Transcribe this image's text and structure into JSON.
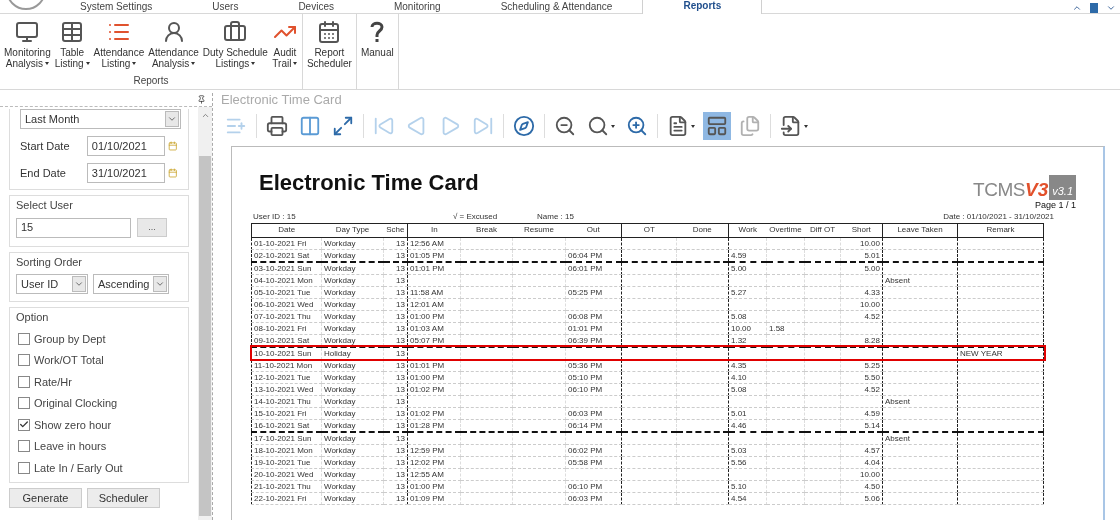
{
  "ribbon": {
    "tabs": [
      {
        "label": "System Settings",
        "selected": false
      },
      {
        "label": "Users",
        "selected": false
      },
      {
        "label": "Devices",
        "selected": false
      },
      {
        "label": "Monitoring",
        "selected": false
      },
      {
        "label": "Scheduling & Attendance",
        "selected": false
      },
      {
        "label": "Reports",
        "selected": true
      }
    ],
    "groups": [
      {
        "label": "Reports",
        "buttons": [
          {
            "kind": "monitor",
            "lines": [
              "Monitoring",
              "Analysis"
            ],
            "dropdown": true
          },
          {
            "kind": "table",
            "lines": [
              "Table",
              "Listing"
            ],
            "dropdown": true
          },
          {
            "kind": "list",
            "lines": [
              "Attendance",
              "Listing"
            ],
            "dropdown": true
          },
          {
            "kind": "person",
            "lines": [
              "Attendance",
              "Analysis"
            ],
            "dropdown": true
          },
          {
            "kind": "briefcase",
            "lines": [
              "Duty Schedule",
              "Listings"
            ],
            "dropdown": true
          },
          {
            "kind": "trend",
            "lines": [
              "Audit",
              "Trail"
            ],
            "dropdown": true
          }
        ]
      },
      {
        "buttons": [
          {
            "kind": "calendar",
            "lines": [
              "Report",
              "Scheduler"
            ],
            "dropdown": false
          }
        ]
      },
      {
        "buttons": [
          {
            "kind": "help",
            "lines": [
              "Manual"
            ],
            "dropdown": false
          }
        ]
      }
    ]
  },
  "filter_panel": {
    "period": "Last Month",
    "start_date": {
      "label": "Start Date",
      "value": "01/10/2021"
    },
    "end_date": {
      "label": "End Date",
      "value": "31/10/2021"
    },
    "select_user": {
      "title": "Select User",
      "value": "15",
      "browse": "..."
    },
    "sorting": {
      "title": "Sorting Order",
      "field": "User ID",
      "order": "Ascending"
    },
    "option": {
      "title": "Option",
      "items": [
        {
          "label": "Group by Dept",
          "checked": false
        },
        {
          "label": "Work/OT Total",
          "checked": false
        },
        {
          "label": "Rate/Hr",
          "checked": false
        },
        {
          "label": "Original Clocking",
          "checked": false
        },
        {
          "label": "Show zero hour",
          "checked": true
        },
        {
          "label": "Leave in hours",
          "checked": false
        },
        {
          "label": "Late In / Early Out",
          "checked": false
        }
      ]
    },
    "buttons": [
      "Generate",
      "Scheduler"
    ]
  },
  "viewer": {
    "title": "Electronic Time Card",
    "toolbar": [
      {
        "kind": "select",
        "disabled": true,
        "selected": false,
        "dropdown": false
      },
      {
        "kind": "print",
        "disabled": false,
        "selected": false,
        "dropdown": false
      },
      {
        "kind": "margins",
        "disabled": false,
        "selected": false,
        "dropdown": false
      },
      {
        "kind": "fit",
        "disabled": false,
        "selected": false,
        "dropdown": false
      },
      {
        "kind": "first",
        "disabled": true,
        "selected": false,
        "dropdown": false
      },
      {
        "kind": "prev",
        "disabled": true,
        "selected": false,
        "dropdown": false
      },
      {
        "kind": "next",
        "disabled": true,
        "selected": false,
        "dropdown": false
      },
      {
        "kind": "last",
        "disabled": true,
        "selected": false,
        "dropdown": false
      },
      {
        "kind": "compass",
        "disabled": false,
        "selected": false,
        "dropdown": false
      },
      {
        "kind": "zoom-out",
        "disabled": false,
        "selected": false,
        "dropdown": false
      },
      {
        "kind": "zoom",
        "disabled": false,
        "selected": false,
        "dropdown": true
      },
      {
        "kind": "zoom-in",
        "disabled": false,
        "selected": false,
        "dropdown": false
      },
      {
        "kind": "document",
        "disabled": false,
        "selected": false,
        "dropdown": true
      },
      {
        "kind": "page-setup",
        "disabled": false,
        "selected": true,
        "dropdown": false
      },
      {
        "kind": "multipage",
        "disabled": true,
        "selected": false,
        "dropdown": false
      },
      {
        "kind": "export",
        "disabled": false,
        "selected": false,
        "dropdown": true
      }
    ]
  },
  "document": {
    "title": "Electronic Time Card",
    "logo": {
      "name": "TCMS",
      "mark": "V3",
      "version": "v3.1"
    },
    "page": "Page 1 / 1",
    "user_id": "User ID : 15",
    "legend": "√ = Excused",
    "name": "Name : 15",
    "date_range": "Date : 01/10/2021 - 31/10/2021",
    "columns": [
      "Date",
      "Day Type",
      "Sche",
      "In",
      "Break",
      "Resume",
      "Out",
      "OT",
      "Done",
      "Work",
      "Overtime",
      "Diff OT",
      "Short",
      "Leave Taken",
      "Remark"
    ],
    "rows": [
      {
        "date": "01-10-2021 Fri",
        "day_type": "Workday",
        "sche": "13",
        "in": "12:56 AM",
        "short": "10.00",
        "week_break": false,
        "highlighted": false
      },
      {
        "date": "02-10-2021 Sat",
        "day_type": "Workday",
        "sche": "13",
        "in": "01:05 PM",
        "out": "06:04 PM",
        "work": "4.59",
        "short": "5.01",
        "week_break": true,
        "highlighted": false
      },
      {
        "date": "03-10-2021 Sun",
        "day_type": "Workday",
        "sche": "13",
        "in": "01:01 PM",
        "out": "06:01 PM",
        "work": "5.00",
        "short": "5.00",
        "week_break": false,
        "highlighted": false
      },
      {
        "date": "04-10-2021 Mon",
        "day_type": "Workday",
        "sche": "13",
        "leave": "Absent",
        "week_break": false,
        "highlighted": false
      },
      {
        "date": "05-10-2021 Tue",
        "day_type": "Workday",
        "sche": "13",
        "in": "11:58 AM",
        "out": "05:25 PM",
        "work": "5.27",
        "short": "4.33",
        "week_break": false,
        "highlighted": false
      },
      {
        "date": "06-10-2021 Wed",
        "day_type": "Workday",
        "sche": "13",
        "in": "12:01 AM",
        "short": "10.00",
        "week_break": false,
        "highlighted": false
      },
      {
        "date": "07-10-2021 Thu",
        "day_type": "Workday",
        "sche": "13",
        "in": "01:00 PM",
        "out": "06:08 PM",
        "work": "5.08",
        "short": "4.52",
        "week_break": false,
        "highlighted": false
      },
      {
        "date": "08-10-2021 Fri",
        "day_type": "Workday",
        "sche": "13",
        "in": "01:03 AM",
        "out": "01:01 PM",
        "work": "10.00",
        "overtime": "1.58",
        "week_break": false,
        "highlighted": false
      },
      {
        "date": "09-10-2021 Sat",
        "day_type": "Workday",
        "sche": "13",
        "in": "05:07 PM",
        "out": "06:39 PM",
        "work": "1.32",
        "short": "8.28",
        "week_break": true,
        "highlighted": false
      },
      {
        "date": "10-10-2021 Sun",
        "day_type": "Holiday",
        "sche": "13",
        "remark": "NEW YEAR",
        "week_break": false,
        "highlighted": true
      },
      {
        "date": "11-10-2021 Mon",
        "day_type": "Workday",
        "sche": "13",
        "in": "01:01 PM",
        "out": "05:36 PM",
        "work": "4.35",
        "short": "5.25",
        "week_break": false,
        "highlighted": false
      },
      {
        "date": "12-10-2021 Tue",
        "day_type": "Workday",
        "sche": "13",
        "in": "01:00 PM",
        "out": "05:10 PM",
        "work": "4.10",
        "short": "5.50",
        "week_break": false,
        "highlighted": false
      },
      {
        "date": "13-10-2021 Wed",
        "day_type": "Workday",
        "sche": "13",
        "in": "01:02 PM",
        "out": "06:10 PM",
        "work": "5.08",
        "short": "4.52",
        "week_break": false,
        "highlighted": false
      },
      {
        "date": "14-10-2021 Thu",
        "day_type": "Workday",
        "sche": "13",
        "leave": "Absent",
        "week_break": false,
        "highlighted": false
      },
      {
        "date": "15-10-2021 Fri",
        "day_type": "Workday",
        "sche": "13",
        "in": "01:02 PM",
        "out": "06:03 PM",
        "work": "5.01",
        "short": "4.59",
        "week_break": false,
        "highlighted": false
      },
      {
        "date": "16-10-2021 Sat",
        "day_type": "Workday",
        "sche": "13",
        "in": "01:28 PM",
        "out": "06:14 PM",
        "work": "4.46",
        "short": "5.14",
        "week_break": true,
        "highlighted": false
      },
      {
        "date": "17-10-2021 Sun",
        "day_type": "Workday",
        "sche": "13",
        "leave": "Absent",
        "week_break": false,
        "highlighted": false
      },
      {
        "date": "18-10-2021 Mon",
        "day_type": "Workday",
        "sche": "13",
        "in": "12:59 PM",
        "out": "06:02 PM",
        "work": "5.03",
        "short": "4.57",
        "week_break": false,
        "highlighted": false
      },
      {
        "date": "19-10-2021 Tue",
        "day_type": "Workday",
        "sche": "13",
        "in": "12:02 PM",
        "out": "05:58 PM",
        "work": "5.56",
        "short": "4.04",
        "week_break": false,
        "highlighted": false
      },
      {
        "date": "20-10-2021 Wed",
        "day_type": "Workday",
        "sche": "13",
        "in": "12:55 AM",
        "short": "10.00",
        "week_break": false,
        "highlighted": false
      },
      {
        "date": "21-10-2021 Thu",
        "day_type": "Workday",
        "sche": "13",
        "in": "01:00 PM",
        "out": "06:10 PM",
        "work": "5.10",
        "short": "4.50",
        "week_break": false,
        "highlighted": false
      },
      {
        "date": "22-10-2021 Fri",
        "day_type": "Workday",
        "sche": "13",
        "in": "01:09 PM",
        "out": "06:03 PM",
        "work": "4.54",
        "short": "5.06",
        "week_break": false,
        "highlighted": false
      }
    ]
  }
}
